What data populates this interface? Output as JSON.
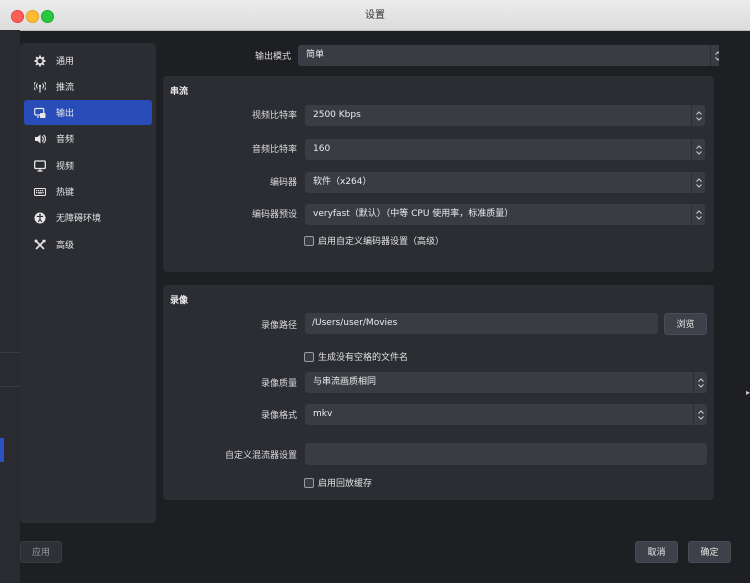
{
  "window": {
    "title": "设置"
  },
  "sidebar": {
    "items": [
      {
        "label": "通用",
        "icon": "gear-icon"
      },
      {
        "label": "推流",
        "icon": "antenna-icon"
      },
      {
        "label": "输出",
        "icon": "output-icon",
        "active": true
      },
      {
        "label": "音频",
        "icon": "speaker-icon"
      },
      {
        "label": "视频",
        "icon": "monitor-icon"
      },
      {
        "label": "热键",
        "icon": "keyboard-icon"
      },
      {
        "label": "无障碍环境",
        "icon": "accessibility-icon"
      },
      {
        "label": "高级",
        "icon": "tools-icon"
      }
    ]
  },
  "output_mode": {
    "label": "输出模式",
    "value": "简单"
  },
  "streaming": {
    "title": "串流",
    "video_bitrate": {
      "label": "视频比特率",
      "value": "2500 Kbps"
    },
    "audio_bitrate": {
      "label": "音频比特率",
      "value": "160"
    },
    "encoder": {
      "label": "编码器",
      "value": "软件（x264）"
    },
    "encoder_preset": {
      "label": "编码器预设",
      "value": "veryfast（默认）（中等 CPU 使用率，标准质量）"
    },
    "custom_encoder_checkbox": {
      "label": "启用自定义编码器设置（高级）"
    }
  },
  "recording": {
    "title": "录像",
    "path": {
      "label": "录像路径",
      "value": "/Users/user/Movies"
    },
    "browse_label": "浏览",
    "no_space_checkbox": {
      "label": "生成没有空格的文件名"
    },
    "quality": {
      "label": "录像质量",
      "value": "与串流画质相同"
    },
    "format": {
      "label": "录像格式",
      "value": "mkv"
    },
    "muxer": {
      "label": "自定义混流器设置",
      "value": ""
    },
    "replay_buffer_checkbox": {
      "label": "启用回放缓存"
    }
  },
  "footer": {
    "apply_label": "应用",
    "cancel_label": "取消",
    "ok_label": "确定"
  },
  "colors": {
    "accent": "#284cb8",
    "panel": "#2b2d33",
    "background": "#1e1f23"
  }
}
